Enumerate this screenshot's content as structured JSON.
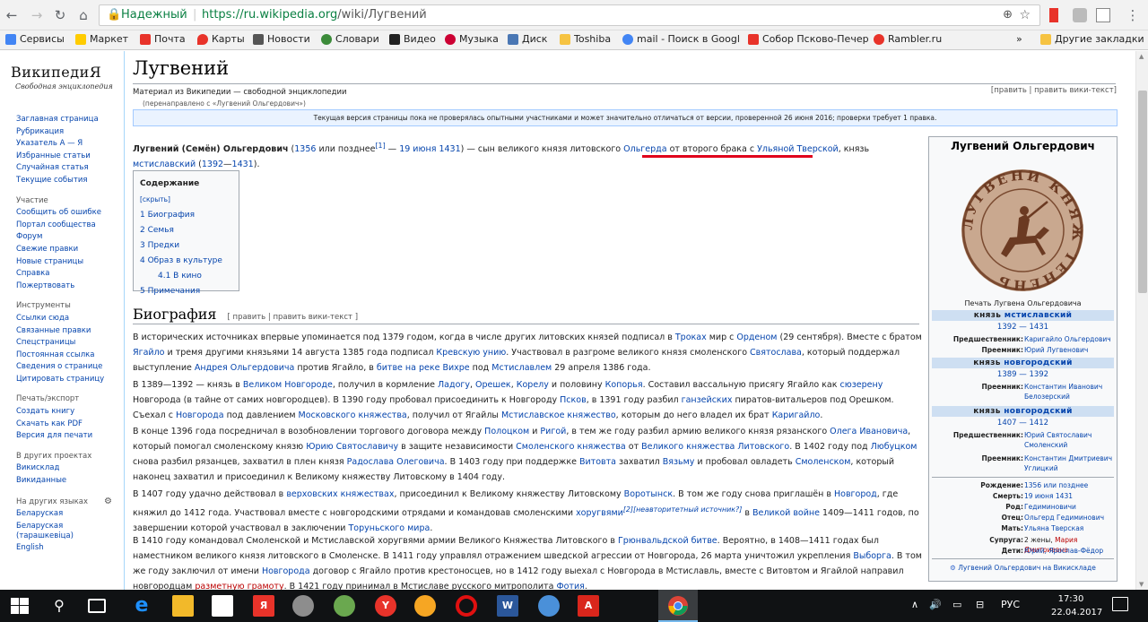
{
  "browser": {
    "secure_label": "Надежный",
    "url_base": "https://ru.wikipedia.org",
    "url_path": "/wiki/Лугвений",
    "bookmarks": [
      {
        "label": "Сервисы",
        "color": "#4285f4"
      },
      {
        "label": "Маркет",
        "color": "#ffcc00"
      },
      {
        "label": "Почта",
        "color": "#e8332a"
      },
      {
        "label": "Карты",
        "color": "#e8332a"
      },
      {
        "label": "Новости",
        "color": "#555"
      },
      {
        "label": "Словари",
        "color": "#3c8b3a"
      },
      {
        "label": "Видео",
        "color": "#222"
      },
      {
        "label": "Музыка",
        "color": "#c03"
      },
      {
        "label": "Диск",
        "color": "#4a77b4"
      },
      {
        "label": "Toshiba",
        "color": "#f6c342"
      },
      {
        "label": "mail - Поиск в Googl",
        "color": "#4285f4"
      },
      {
        "label": "Собор Псково-Печер",
        "color": "#e8332a"
      },
      {
        "label": "Rambler.ru",
        "color": "#e8332a"
      }
    ],
    "bookmarks_overflow": "»",
    "other_bookmarks": "Другие закладки"
  },
  "wiki": {
    "logo": "ВикипедиЯ",
    "logo_sub": "Свободная энциклопедия",
    "nav": [
      "Заглавная страница",
      "Рубрикация",
      "Указатель А — Я",
      "Избранные статьи",
      "Случайная статья",
      "Текущие события"
    ],
    "participate_head": "Участие",
    "participate": [
      "Сообщить об ошибке",
      "Портал сообщества",
      "Форум",
      "Свежие правки",
      "Новые страницы",
      "Справка",
      "Пожертвовать"
    ],
    "tools_head": "Инструменты",
    "tools": [
      "Ссылки сюда",
      "Связанные правки",
      "Спецстраницы",
      "Постоянная ссылка",
      "Сведения о странице",
      "Цитировать страницу"
    ],
    "print_head": "Печать/экспорт",
    "print": [
      "Создать книгу",
      "Скачать как PDF",
      "Версия для печати"
    ],
    "projects_head": "В других проектах",
    "projects": [
      "Викисклад",
      "Викиданные"
    ],
    "lang_head": "На других языках",
    "langs": [
      "Беларуская",
      "Беларуская (тарашкевіца)",
      "English"
    ]
  },
  "article": {
    "title": "Лугвений",
    "sitesub": "Материал из Википедии — свободной энциклопедии",
    "edit_links": "[править | править вики-текст]",
    "redirect": "(перенаправлено с «Лугвений Ольгердович»)",
    "notice": "Текущая версия страницы пока не проверялась опытными участниками и может значительно отличаться от версии, проверенной 26 июня 2016; проверки требует 1 правка.",
    "toc": {
      "title": "Содержание",
      "hide": "[скрыть]",
      "items": [
        "1 Биография",
        "2 Семья",
        "3 Предки",
        "4 Образ в культуре",
        "4.1 В кино",
        "5 Примечания"
      ]
    },
    "section_title": "Биография",
    "section_edit": "[ править | править вики-текст ]"
  },
  "infobox": {
    "title": "Лугвений Ольгердович",
    "seal_text": "ЛУГВЕНИ КНЯЖ ТЕНЕНЬ",
    "caption": "Печать Лугвена Ольгердовича",
    "h1": "князь мстиславский",
    "d1": "1392 — 1431",
    "pred1_k": "Предшественник:",
    "pred1_v": "Каригайло Ольгердович",
    "succ1_k": "Преемник:",
    "succ1_v": "Юрий Лугвенович",
    "h2": "князь новгородский",
    "d2": "1389 — 1392",
    "succ2_k": "Преемник:",
    "succ2_v": "Константин Иванович Белозерский",
    "h3": "князь новгородский",
    "d3": "1407 — 1412",
    "pred3_k": "Предшественник:",
    "pred3_v": "Юрий Святославич Смоленский",
    "succ3_k": "Преемник:",
    "succ3_v": "Константин Дмитриевич Углицкий",
    "birth_k": "Рождение:",
    "birth_v": "1356 или позднее",
    "death_k": "Смерть:",
    "death_v": "19 июня 1431",
    "kin_k": "Род:",
    "kin_v": "Гедиминовичи",
    "father_k": "Отец:",
    "father_v": "Ольгерд Гедиминович",
    "mother_k": "Мать:",
    "mother_v": "Ульяна Тверская",
    "spouse_k": "Супруга:",
    "spouse_v": "2 жены,",
    "spouse_v2": "Мария Дмитриевна",
    "children_k": "Дети:",
    "children_v": "Юрий, Ярослав-Фёдор",
    "commons": "Лугвений Ольгердович на Викискладе"
  },
  "taskbar": {
    "lang": "РУС",
    "time": "17:30",
    "date": "22.04.2017"
  }
}
